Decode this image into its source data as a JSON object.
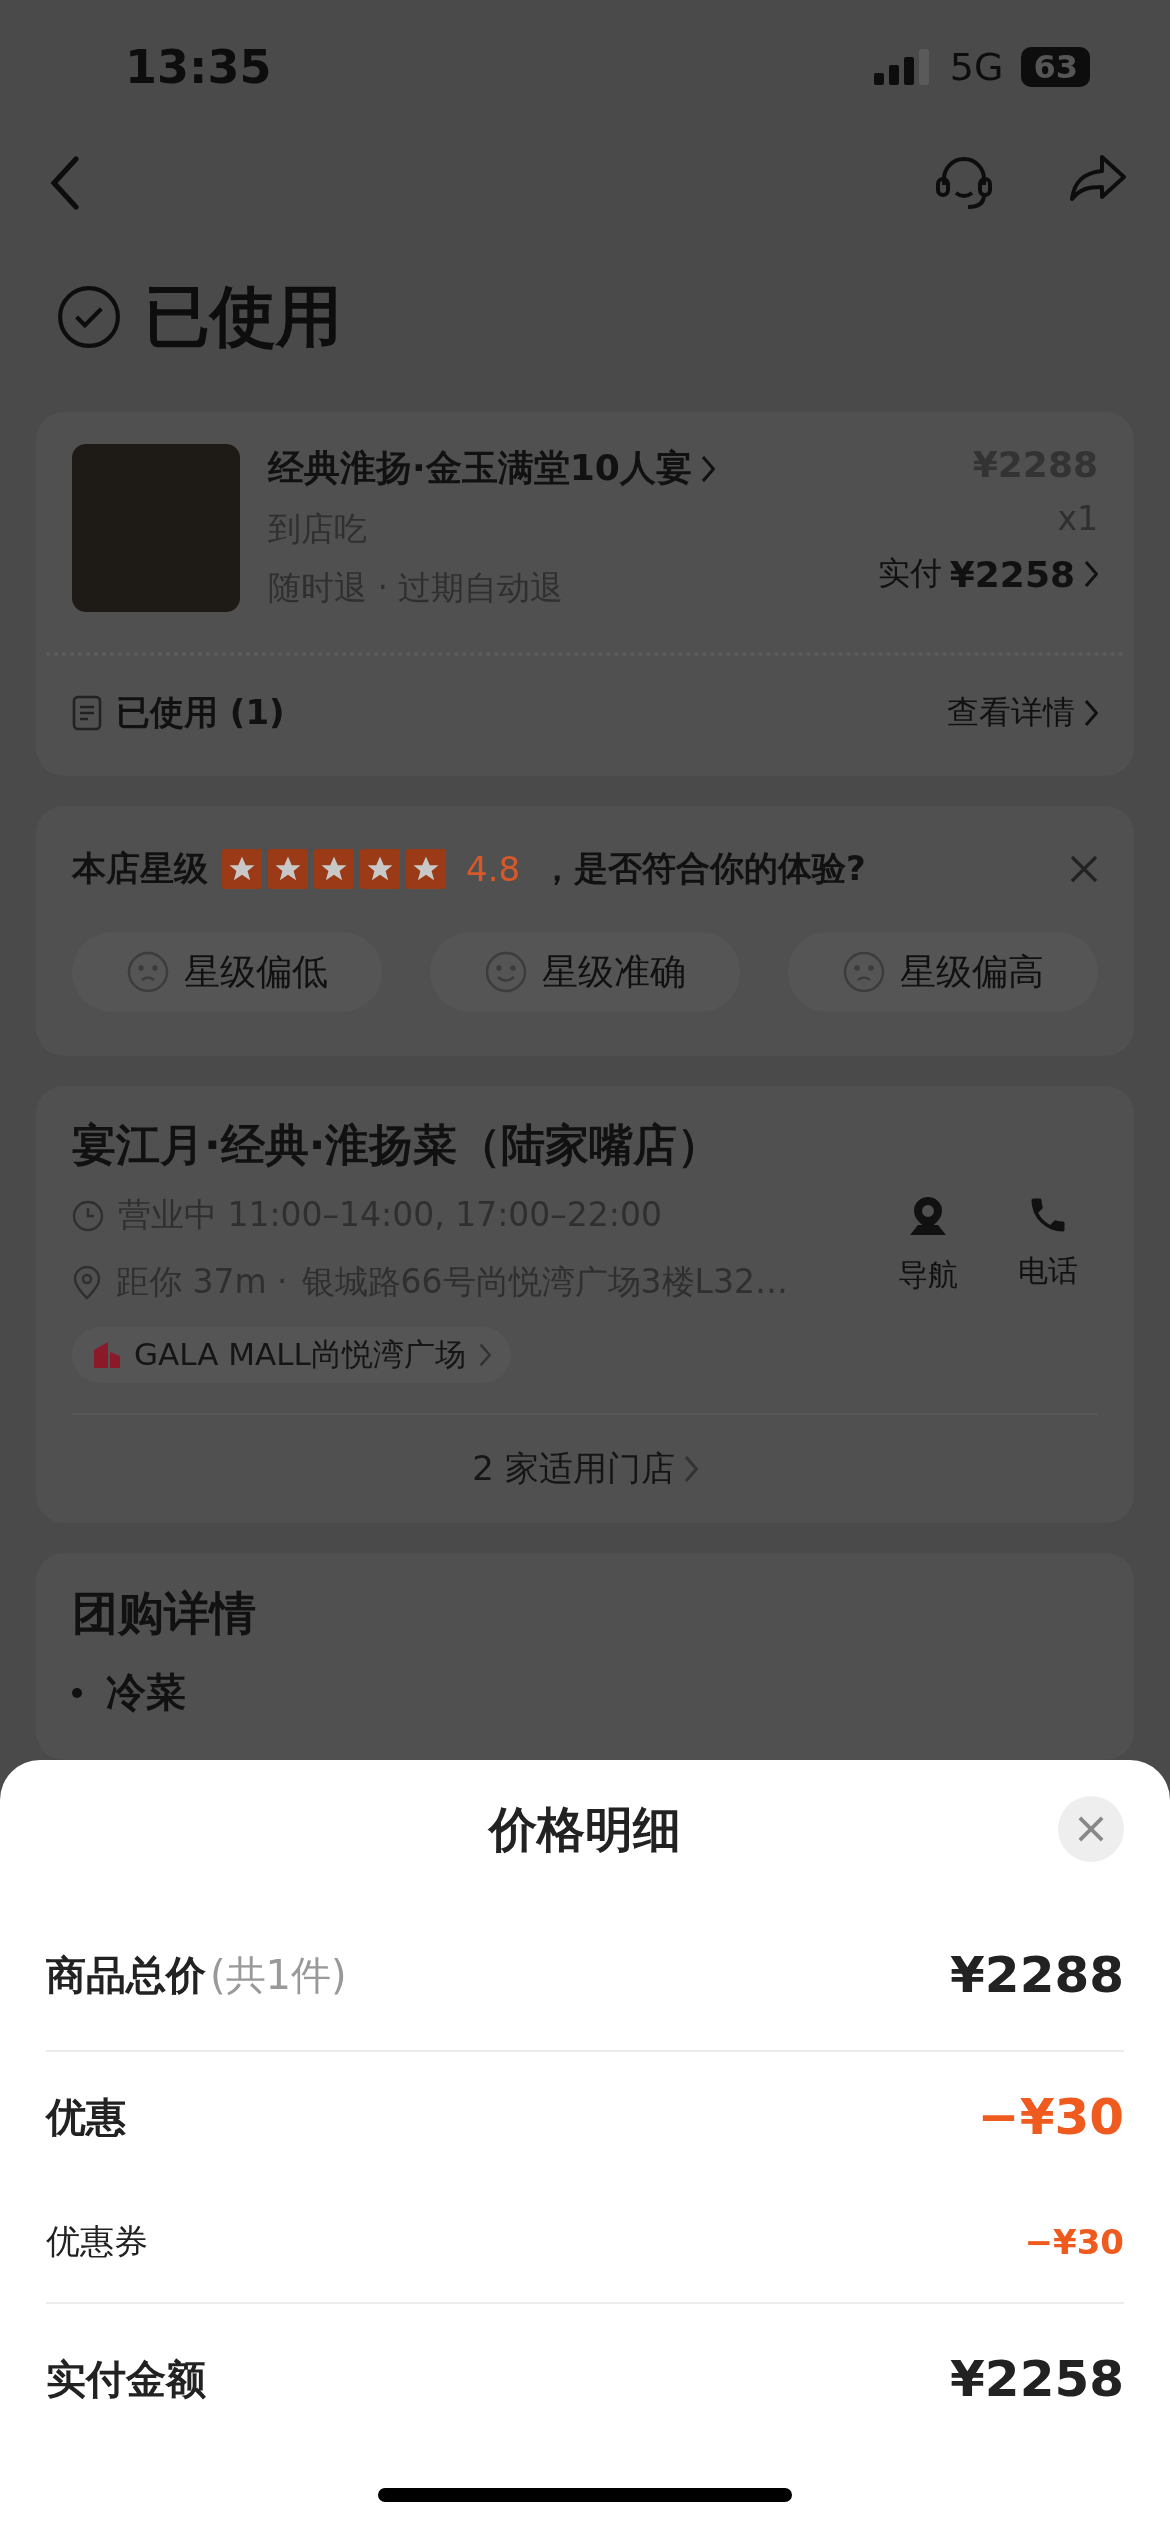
{
  "status_bar": {
    "time": "13:35",
    "network": "5G",
    "battery": "63"
  },
  "status": {
    "title": "已使用"
  },
  "order": {
    "name": "经典淮扬·金玉满堂10人宴",
    "type": "到店吃",
    "refund_policy": "随时退 · 过期自动退",
    "price": "¥2288",
    "quantity": "x1",
    "paid_label": "实付",
    "paid_amount": "¥2258",
    "used_label": "已使用 (1)",
    "detail_link": "查看详情"
  },
  "rating": {
    "label": "本店星级",
    "stars": 5,
    "score": "4.8",
    "question": "，是否符合你的体验?",
    "options": [
      {
        "label": "星级偏低",
        "kind": "sad"
      },
      {
        "label": "星级准确",
        "kind": "smile"
      },
      {
        "label": "星级偏高",
        "kind": "sad"
      }
    ]
  },
  "store": {
    "name": "宴江月·经典·淮扬菜（陆家嘴店）",
    "hours": "营业中 11:00–14:00, 17:00–22:00",
    "distance": "距你 37m ·",
    "address": "银城路66号尚悦湾广场3楼L32…",
    "mall": "GALA MALL尚悦湾广场",
    "stores_link": "2 家适用门店",
    "actions": [
      {
        "label": "导航",
        "kind": "nav"
      },
      {
        "label": "电话",
        "kind": "phone"
      }
    ]
  },
  "group_detail": {
    "title": "团购详情",
    "items": [
      "冷菜"
    ]
  },
  "price_sheet": {
    "title": "价格明细",
    "rows": [
      {
        "kind": "total",
        "label": "商品总价",
        "note": "(共1件)",
        "amount": "¥2288"
      },
      {
        "kind": "discount",
        "label": "优惠",
        "amount": "−¥30"
      },
      {
        "kind": "sub",
        "label": "优惠券",
        "amount": "−¥30"
      },
      {
        "kind": "paid",
        "label": "实付金额",
        "amount": "¥2258"
      }
    ]
  }
}
